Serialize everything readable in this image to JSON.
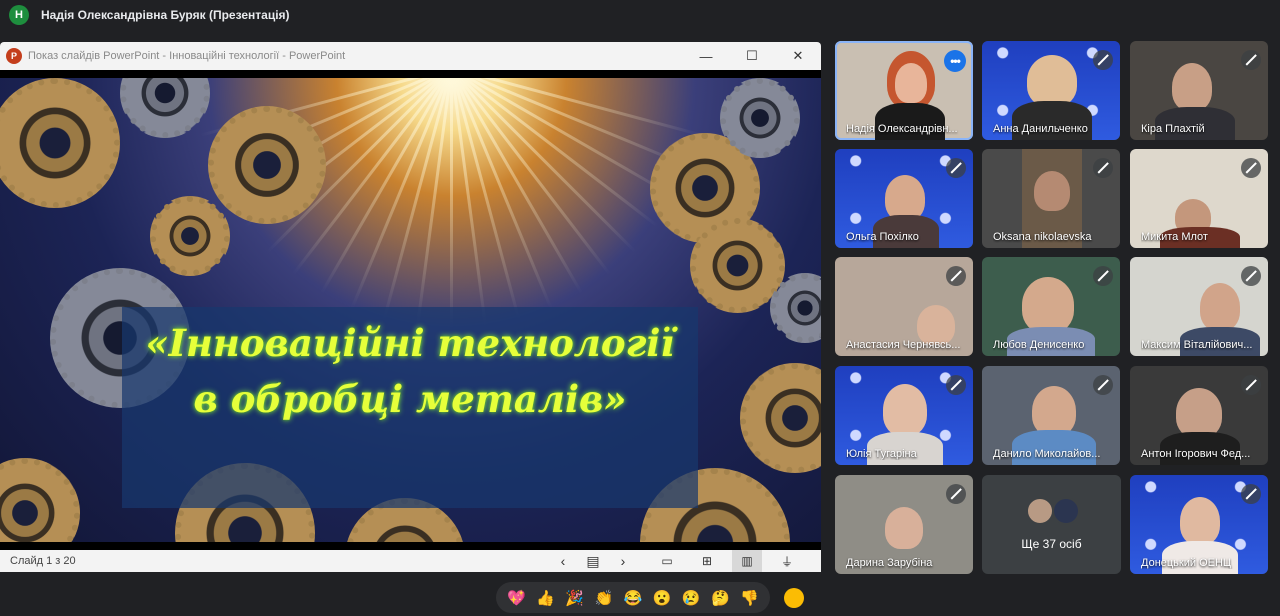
{
  "meet": {
    "avatar_letter": "Н",
    "presenter_title": "Надія Олександрівна Буряк (Презентація)"
  },
  "powerpoint": {
    "logo_letter": "P",
    "window_title": "Показ слайдів PowerPoint  -  Інноваційні технології - PowerPoint",
    "minimize_glyph": "—",
    "maximize_glyph": "☐",
    "close_glyph": "✕",
    "slide_title_line1": "«Інноваційні технології",
    "slide_title_line2": "в обробці металів»",
    "slide_counter": "Слайд 1 з 20",
    "nav_prev": "‹",
    "nav_list": "▤",
    "nav_next": "›",
    "view_icons": [
      "▭",
      "⊞",
      "▥",
      "⏚"
    ]
  },
  "participants": [
    {
      "name": "Надія Олександрівн...",
      "speaking": true
    },
    {
      "name": "Анна Данильченко",
      "muted": true
    },
    {
      "name": "Кіра Плахтій",
      "muted": true
    },
    {
      "name": "Ольга Похілко",
      "muted": true
    },
    {
      "name": "Oksana nikolaevska",
      "muted": true
    },
    {
      "name": "Микита Млот",
      "muted": true
    },
    {
      "name": "Анастасия Чернявсь...",
      "muted": true
    },
    {
      "name": "Любов Денисенко",
      "muted": true
    },
    {
      "name": "Максим Віталійович...",
      "muted": true
    },
    {
      "name": "Юлія Тугаріна",
      "muted": true
    },
    {
      "name": "Данило Миколайов...",
      "muted": true
    },
    {
      "name": "Антон Ігорович Фед...",
      "muted": true
    },
    {
      "name": "Дарина Зарубіна",
      "muted": true
    },
    {
      "name": "Донецький ОЕНЦ",
      "muted": true
    }
  ],
  "others_label": "Ще 37 осіб",
  "more_options": "•••",
  "reactions": [
    "💖",
    "👍",
    "🎉",
    "👏",
    "😂",
    "😮",
    "😢",
    "🤔",
    "👎"
  ]
}
